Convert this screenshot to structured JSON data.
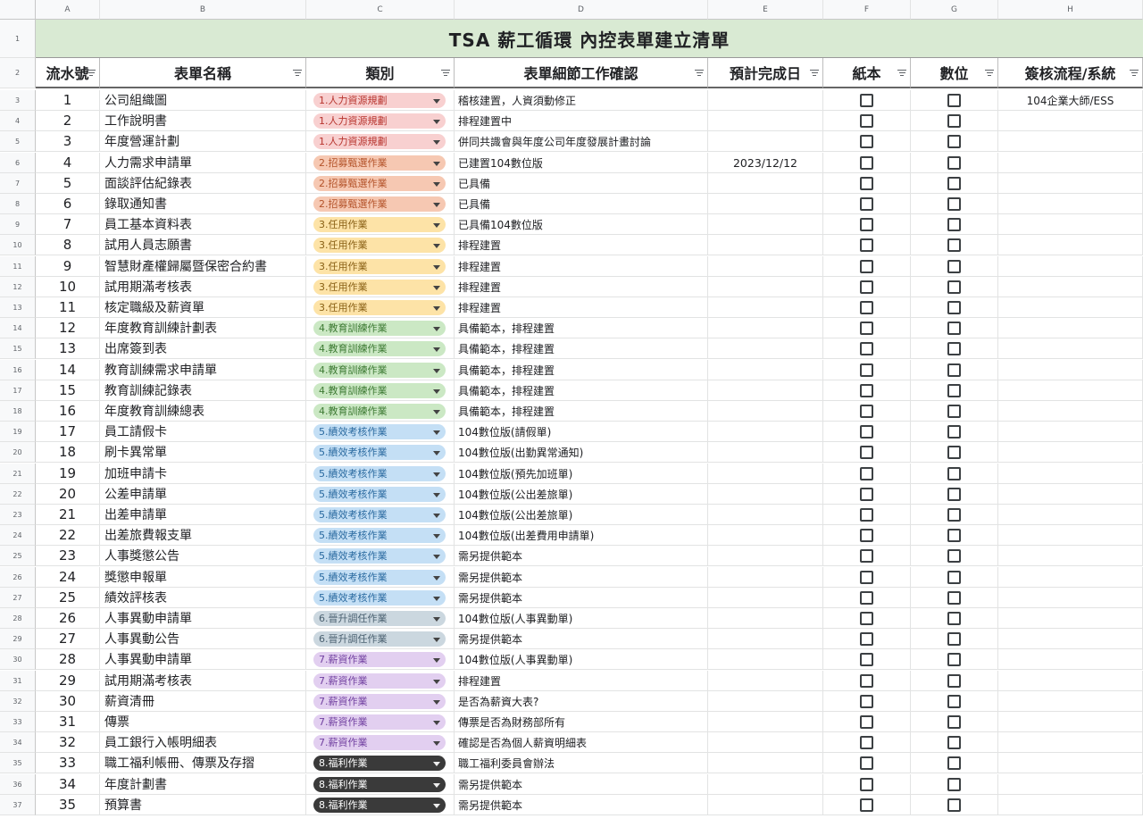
{
  "columns": [
    "A",
    "B",
    "C",
    "D",
    "E",
    "F",
    "G",
    "H"
  ],
  "title": "TSA 薪工循環 內控表單建立清單",
  "headers": {
    "a": "流水號",
    "b": "表單名稱",
    "c": "類別",
    "d": "表單細節工作確認",
    "e": "預計完成日",
    "f": "紙本",
    "g": "數位",
    "h": "簽核流程/系統"
  },
  "categories": {
    "c1": {
      "label": "1.人力資源規劃",
      "bg": "#f8d0d0",
      "fg": "#b7332d"
    },
    "c2": {
      "label": "2.招募甄選作業",
      "bg": "#f6c8b2",
      "fg": "#b4532a"
    },
    "c3": {
      "label": "3.任用作業",
      "bg": "#fde3a7",
      "fg": "#8a6116"
    },
    "c4": {
      "label": "4.教育訓練作業",
      "bg": "#cbe8c4",
      "fg": "#3d7a33"
    },
    "c5": {
      "label": "5.績效考核作業",
      "bg": "#c4dff5",
      "fg": "#2a6aa0"
    },
    "c6": {
      "label": "6.晉升調任作業",
      "bg": "#cbd7df",
      "fg": "#4a6070"
    },
    "c7": {
      "label": "7.薪資作業",
      "bg": "#e2cff0",
      "fg": "#7140a0"
    },
    "c8": {
      "label": "8.福利作業",
      "bg": "#3a3a3a",
      "fg": "#ffffff"
    }
  },
  "rows": [
    {
      "rn": "3",
      "no": "1",
      "name": "公司組織圖",
      "cat": "c1",
      "detail": "稽核建置，人資須動修正",
      "date": "",
      "sys": "104企業大師/ESS"
    },
    {
      "rn": "4",
      "no": "2",
      "name": "工作說明書",
      "cat": "c1",
      "detail": "排程建置中",
      "date": "",
      "sys": ""
    },
    {
      "rn": "5",
      "no": "3",
      "name": "年度營運計劃",
      "cat": "c1",
      "detail": "併同共識會與年度公司年度發展計畫討論",
      "date": "",
      "sys": ""
    },
    {
      "rn": "6",
      "no": "4",
      "name": "人力需求申請單",
      "cat": "c2",
      "detail": "已建置104數位版",
      "date": "2023/12/12",
      "sys": ""
    },
    {
      "rn": "7",
      "no": "5",
      "name": "面談評估紀錄表",
      "cat": "c2",
      "detail": "已具備",
      "date": "",
      "sys": ""
    },
    {
      "rn": "8",
      "no": "6",
      "name": "錄取通知書",
      "cat": "c2",
      "detail": "已具備",
      "date": "",
      "sys": ""
    },
    {
      "rn": "9",
      "no": "7",
      "name": "員工基本資料表",
      "cat": "c3",
      "detail": "已具備104數位版",
      "date": "",
      "sys": ""
    },
    {
      "rn": "10",
      "no": "8",
      "name": "試用人員志願書",
      "cat": "c3",
      "detail": "排程建置",
      "date": "",
      "sys": ""
    },
    {
      "rn": "11",
      "no": "9",
      "name": "智慧財產權歸屬暨保密合約書",
      "cat": "c3",
      "detail": "排程建置",
      "date": "",
      "sys": ""
    },
    {
      "rn": "12",
      "no": "10",
      "name": "試用期滿考核表",
      "cat": "c3",
      "detail": "排程建置",
      "date": "",
      "sys": ""
    },
    {
      "rn": "13",
      "no": "11",
      "name": "核定職級及薪資單",
      "cat": "c3",
      "detail": "排程建置",
      "date": "",
      "sys": ""
    },
    {
      "rn": "14",
      "no": "12",
      "name": "年度教育訓練計劃表",
      "cat": "c4",
      "detail": "具備範本，排程建置",
      "date": "",
      "sys": ""
    },
    {
      "rn": "15",
      "no": "13",
      "name": "出席簽到表",
      "cat": "c4",
      "detail": "具備範本，排程建置",
      "date": "",
      "sys": ""
    },
    {
      "rn": "16",
      "no": "14",
      "name": "教育訓練需求申請單",
      "cat": "c4",
      "detail": "具備範本，排程建置",
      "date": "",
      "sys": ""
    },
    {
      "rn": "17",
      "no": "15",
      "name": "教育訓練記錄表",
      "cat": "c4",
      "detail": "具備範本，排程建置",
      "date": "",
      "sys": ""
    },
    {
      "rn": "18",
      "no": "16",
      "name": "年度教育訓練總表",
      "cat": "c4",
      "detail": "具備範本，排程建置",
      "date": "",
      "sys": ""
    },
    {
      "rn": "19",
      "no": "17",
      "name": "員工請假卡",
      "cat": "c5",
      "detail": "104數位版(請假單)",
      "date": "",
      "sys": ""
    },
    {
      "rn": "20",
      "no": "18",
      "name": "刷卡異常單",
      "cat": "c5",
      "detail": "104數位版(出勤異常通知)",
      "date": "",
      "sys": ""
    },
    {
      "rn": "21",
      "no": "19",
      "name": "加班申請卡",
      "cat": "c5",
      "detail": "104數位版(預先加班單)",
      "date": "",
      "sys": ""
    },
    {
      "rn": "22",
      "no": "20",
      "name": "公差申請單",
      "cat": "c5",
      "detail": "104數位版(公出差旅單)",
      "date": "",
      "sys": ""
    },
    {
      "rn": "23",
      "no": "21",
      "name": "出差申請單",
      "cat": "c5",
      "detail": "104數位版(公出差旅單)",
      "date": "",
      "sys": ""
    },
    {
      "rn": "24",
      "no": "22",
      "name": "出差旅費報支單",
      "cat": "c5",
      "detail": "104數位版(出差費用申請單)",
      "date": "",
      "sys": ""
    },
    {
      "rn": "25",
      "no": "23",
      "name": "人事獎懲公告",
      "cat": "c5",
      "detail": "需另提供範本",
      "date": "",
      "sys": ""
    },
    {
      "rn": "26",
      "no": "24",
      "name": "獎懲申報單",
      "cat": "c5",
      "detail": "需另提供範本",
      "date": "",
      "sys": ""
    },
    {
      "rn": "27",
      "no": "25",
      "name": "績效評核表",
      "cat": "c5",
      "detail": "需另提供範本",
      "date": "",
      "sys": ""
    },
    {
      "rn": "28",
      "no": "26",
      "name": "人事異動申請單",
      "cat": "c6",
      "detail": "104數位版(人事異動單)",
      "date": "",
      "sys": ""
    },
    {
      "rn": "29",
      "no": "27",
      "name": "人事異動公告",
      "cat": "c6",
      "detail": "需另提供範本",
      "date": "",
      "sys": ""
    },
    {
      "rn": "30",
      "no": "28",
      "name": "人事異動申請單",
      "cat": "c7",
      "detail": "104數位版(人事異動單)",
      "date": "",
      "sys": ""
    },
    {
      "rn": "31",
      "no": "29",
      "name": "試用期滿考核表",
      "cat": "c7",
      "detail": "排程建置",
      "date": "",
      "sys": ""
    },
    {
      "rn": "32",
      "no": "30",
      "name": "薪資清冊",
      "cat": "c7",
      "detail": "是否為薪資大表?",
      "date": "",
      "sys": ""
    },
    {
      "rn": "33",
      "no": "31",
      "name": "傳票",
      "cat": "c7",
      "detail": "傳票是否為財務部所有",
      "date": "",
      "sys": ""
    },
    {
      "rn": "34",
      "no": "32",
      "name": "員工銀行入帳明細表",
      "cat": "c7",
      "detail": "確認是否為個人薪資明細表",
      "date": "",
      "sys": ""
    },
    {
      "rn": "35",
      "no": "33",
      "name": "職工福利帳冊、傳票及存摺",
      "cat": "c8",
      "detail": "職工福利委員會辦法",
      "date": "",
      "sys": ""
    },
    {
      "rn": "36",
      "no": "34",
      "name": "年度計劃書",
      "cat": "c8",
      "detail": "需另提供範本",
      "date": "",
      "sys": ""
    },
    {
      "rn": "37",
      "no": "35",
      "name": "預算書",
      "cat": "c8",
      "detail": "需另提供範本",
      "date": "",
      "sys": ""
    }
  ]
}
